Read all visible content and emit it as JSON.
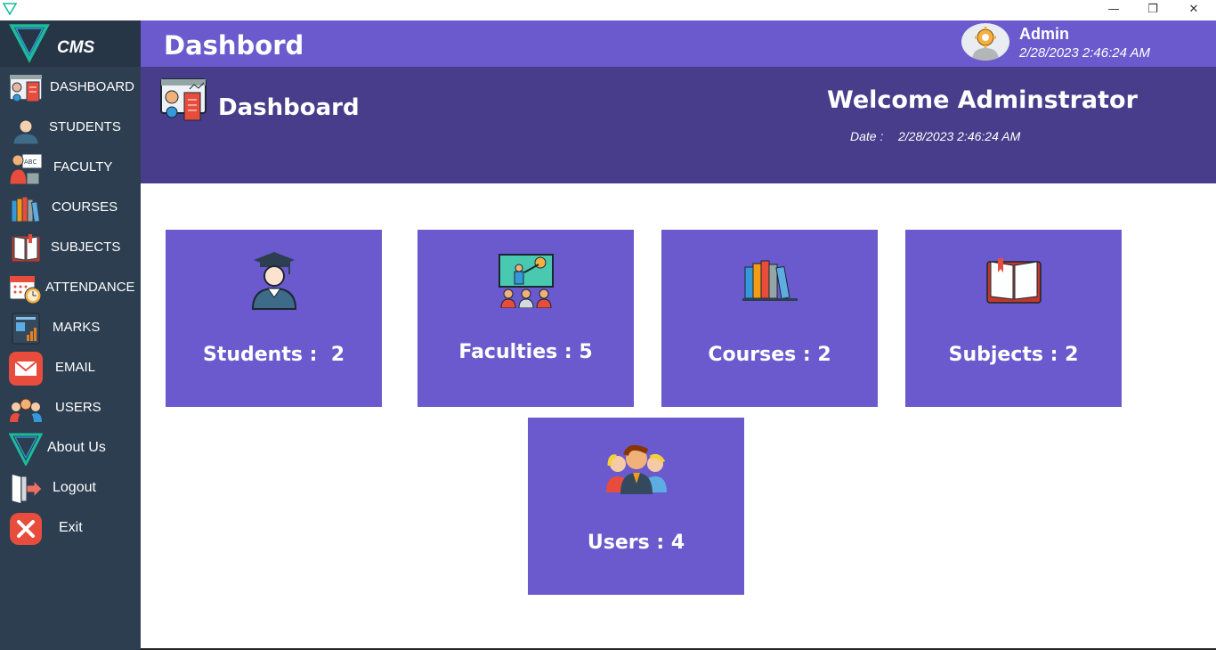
{
  "window": {
    "minimize": "—",
    "restore": "❐",
    "close": "✕"
  },
  "sidebar": {
    "brand": "CMS",
    "items": [
      {
        "label": "DASHBOARD",
        "icon": "dashboard-icon"
      },
      {
        "label": "STUDENTS",
        "icon": "student-icon"
      },
      {
        "label": "FACULTY",
        "icon": "faculty-icon"
      },
      {
        "label": "COURSES",
        "icon": "books-icon"
      },
      {
        "label": "SUBJECTS",
        "icon": "book-icon"
      },
      {
        "label": "ATTENDANCE",
        "icon": "calendar-clock-icon"
      },
      {
        "label": "MARKS",
        "icon": "report-icon"
      },
      {
        "label": "EMAIL",
        "icon": "email-icon"
      },
      {
        "label": "USERS",
        "icon": "users-icon"
      },
      {
        "label": "About Us",
        "icon": "logo-icon"
      },
      {
        "label": "Logout",
        "icon": "logout-icon"
      },
      {
        "label": "Exit",
        "icon": "exit-icon"
      }
    ]
  },
  "header": {
    "title": "Dashbord",
    "admin_name": "Admin",
    "admin_time": "2/28/2023 2:46:24 AM"
  },
  "banner": {
    "title": "Dashboard",
    "welcome": "Welcome Adminstrator",
    "date_label": "Date :",
    "date_value": "2/28/2023 2:46:24 AM"
  },
  "cards": {
    "students": "Students :  2",
    "faculties": "Faculties : 5",
    "courses": "Courses : 2",
    "subjects": "Subjects : 2",
    "users": "Users : 4"
  },
  "colors": {
    "sidebar": "#2c3e50",
    "header": "#6a5acd",
    "banner": "#483d8b",
    "card": "#6a5acd"
  }
}
